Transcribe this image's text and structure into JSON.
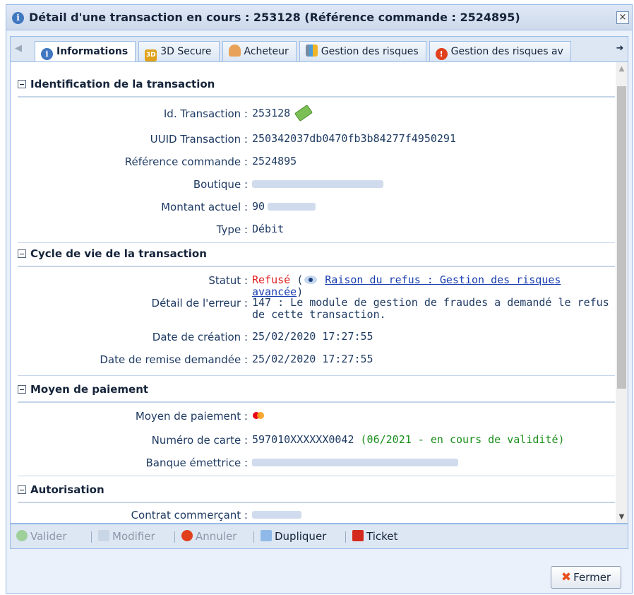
{
  "window": {
    "title": "Détail d'une transaction en cours : 253128 (Référence commande : 2524895)",
    "close_glyph": "×"
  },
  "tabs": [
    {
      "label": "Informations",
      "icon": "info-icon",
      "active": true
    },
    {
      "label": "3D Secure",
      "icon": "3d-secure-icon",
      "active": false
    },
    {
      "label": "Acheteur",
      "icon": "buyer-icon",
      "active": false
    },
    {
      "label": "Gestion des risques",
      "icon": "risk-chart-icon",
      "active": false
    },
    {
      "label": "Gestion des risques av",
      "icon": "alert-icon",
      "active": false
    }
  ],
  "sections": {
    "identification": {
      "title": "Identification de la transaction",
      "id_label": "Id. Transaction :",
      "id_value": "253128",
      "uuid_label": "UUID Transaction :",
      "uuid_value": "250342037db0470fb3b84277f4950291",
      "ref_label": "Référence commande :",
      "ref_value": "2524895",
      "boutique_label": "Boutique :",
      "montant_label": "Montant actuel :",
      "montant_value": "90",
      "type_label": "Type :",
      "type_value": "Débit"
    },
    "cycle": {
      "title": "Cycle de vie de la transaction",
      "statut_label": "Statut :",
      "statut_value": "Refusé",
      "statut_open": " (",
      "statut_link": "Raison du refus : Gestion des risques avancée",
      "statut_close": ")",
      "erreur_label": "Détail de l'erreur :",
      "erreur_value": "147 : Le module de gestion de fraudes a demandé le refus de cette transaction.",
      "creation_label": "Date de création :",
      "creation_value": "25/02/2020 17:27:55",
      "remise_label": "Date de remise demandée :",
      "remise_value": "25/02/2020 17:27:55"
    },
    "paiement": {
      "title": "Moyen de paiement",
      "moyen_label": "Moyen de paiement :",
      "carte_label": "Numéro de carte :",
      "carte_value": "597010XXXXXX0042",
      "carte_validity": "(06/2021 - en cours de validité)",
      "banque_label": "Banque émettrice :"
    },
    "autorisation": {
      "title": "Autorisation",
      "contrat_label": "Contrat commerçant :"
    }
  },
  "toolbar": {
    "valider": "Valider",
    "modifier": "Modifier",
    "annuler": "Annuler",
    "dupliquer": "Dupliquer",
    "ticket": "Ticket"
  },
  "footer": {
    "fermer": "Fermer"
  },
  "colors": {
    "accent": "#3f77c0",
    "refused": "#e02020",
    "valid": "#1c8f1c"
  }
}
